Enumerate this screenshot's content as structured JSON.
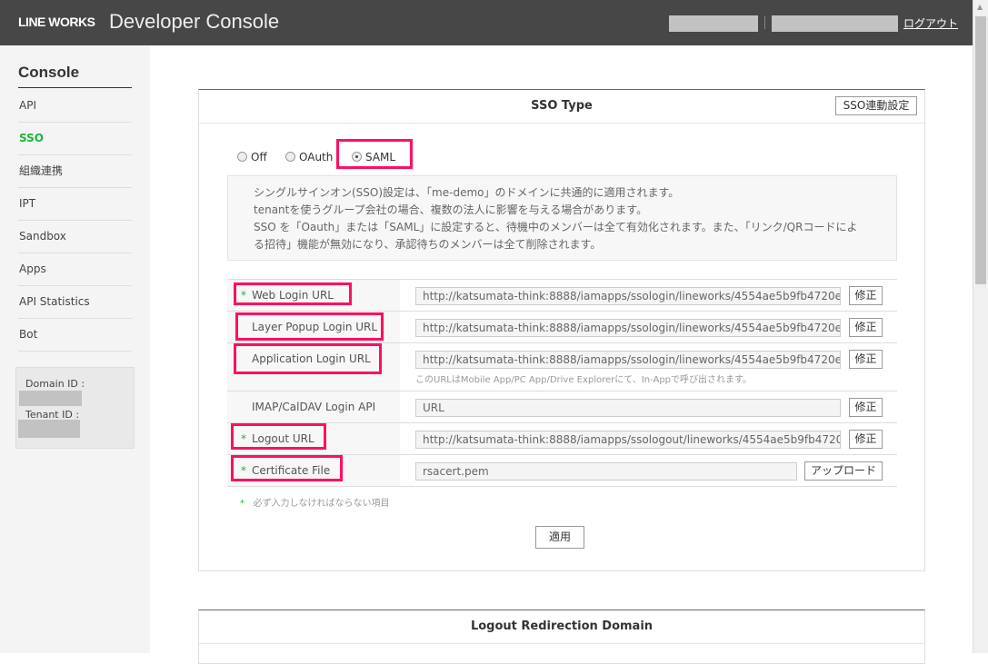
{
  "header": {
    "logo": "LINE WORKS",
    "title": "Developer Console",
    "logout": "ログアウト"
  },
  "sidebar": {
    "title": "Console",
    "items": [
      {
        "label": "API"
      },
      {
        "label": "SSO"
      },
      {
        "label": "組織連携"
      },
      {
        "label": "IPT"
      },
      {
        "label": "Sandbox"
      },
      {
        "label": "Apps"
      },
      {
        "label": "API Statistics"
      },
      {
        "label": "Bot"
      }
    ],
    "domain_id_label": "Domain ID :",
    "tenant_id_label": "Tenant ID :"
  },
  "sso": {
    "title": "SSO Type",
    "settings_button": "SSO連動設定",
    "options": [
      {
        "label": "Off",
        "selected": false
      },
      {
        "label": "OAuth",
        "selected": false
      },
      {
        "label": "SAML",
        "selected": true
      }
    ],
    "notice": [
      "シングルサインオン(SSO)設定は、「me-demo」のドメインに共通的に適用されます。",
      "tenantを使うグループ会社の場合、複数の法人に影響を与える場合があります。",
      "SSO を「Oauth」または「SAML」に設定すると、待機中のメンバーは全て有効化されます。また、「リンク/QRコードによ",
      "る招待」機能が無効になり、承認待ちのメンバーは全て削除されます。"
    ],
    "fields": [
      {
        "label": "Web Login URL",
        "required": true,
        "value": "http://katsumata-think:8888/iamapps/ssologin/lineworks/4554ae5b9fb4720e",
        "button": "修正"
      },
      {
        "label": "Layer Popup Login URL",
        "required": false,
        "value": "http://katsumata-think:8888/iamapps/ssologin/lineworks/4554ae5b9fb4720e",
        "button": "修正"
      },
      {
        "label": "Application Login URL",
        "required": false,
        "value": "http://katsumata-think:8888/iamapps/ssologin/lineworks/4554ae5b9fb4720e",
        "button": "修正",
        "hint": "このURLはMobile App/PC App/Drive Explorerにて、In-Appで呼び出されます。"
      },
      {
        "label": "IMAP/CalDAV Login API",
        "required": false,
        "value": "URL",
        "button": "修正"
      },
      {
        "label": "Logout URL",
        "required": true,
        "value": "http://katsumata-think:8888/iamapps/ssologout/lineworks/4554ae5b9fb4720",
        "button": "修正"
      },
      {
        "label": "Certificate File",
        "required": true,
        "value": "rsacert.pem",
        "button": "アップロード"
      }
    ],
    "required_star": "*",
    "required_note": "必ず入力しなければならない項目",
    "apply": "適用"
  },
  "logout_panel": {
    "title": "Logout Redirection Domain"
  }
}
